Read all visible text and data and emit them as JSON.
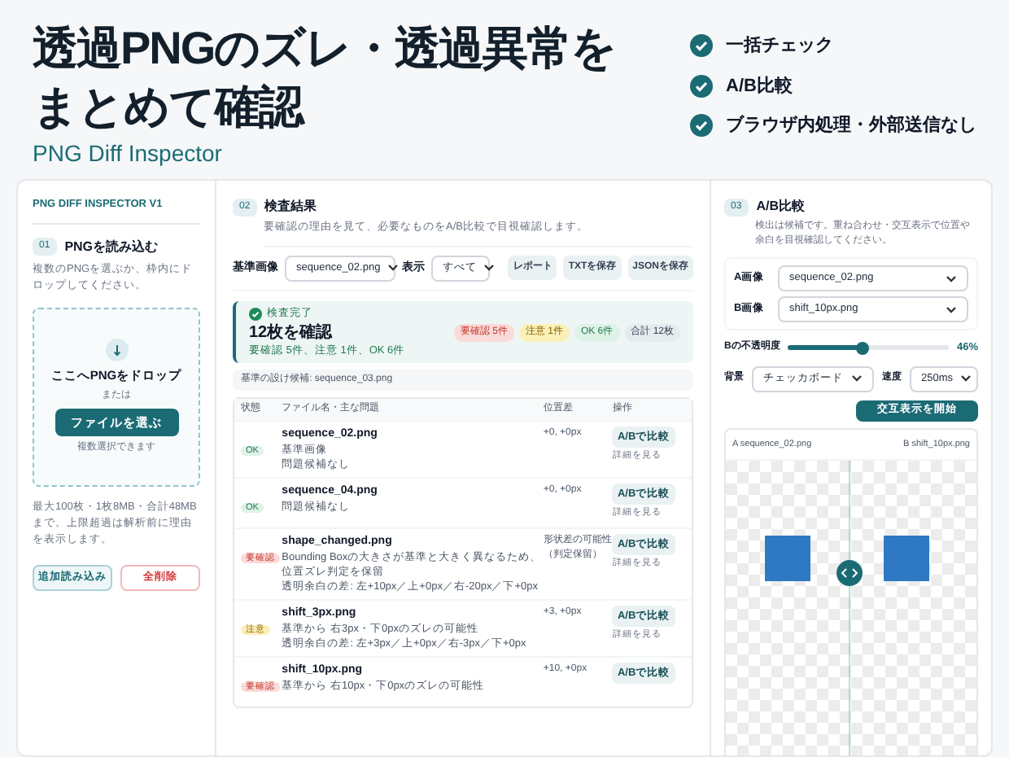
{
  "hero": {
    "title_lines": [
      "透過PNGのズレ・透過異常を",
      "まとめて確認"
    ],
    "subtitle": "PNG Diff Inspector",
    "features": [
      "一括チェック",
      "A/B比較",
      "ブラウザ内処理・外部送信なし"
    ]
  },
  "app_title": "PNG DIFF INSPECTOR V1",
  "load": {
    "step": "01",
    "title": "PNGを読み込む",
    "description": "複数のPNGを選ぶか、枠内にドロップしてください。",
    "drop_title": "ここへPNGをドロップ",
    "or": "または",
    "choose_button": "ファイルを選ぶ",
    "multi_note": "複数選択できます",
    "limits": "最大100枚・1枚8MB・合計48MBまで。上限超過は解析前に理由を表示します。",
    "add_button": "追加読み込み",
    "clear_button": "全削除"
  },
  "results": {
    "step": "02",
    "title": "検査結果",
    "description": "要確認の理由を見て、必要なものをA/B比較で目視確認します。",
    "base_label": "基準画像",
    "base_value": "sequence_02.png",
    "view_label": "表示",
    "view_value": "すべて",
    "actions": [
      "レポート",
      "TXTを保存",
      "JSONを保存"
    ],
    "summary": {
      "status": "検査完了",
      "headline": "12枚を確認",
      "detail": "要確認 5件、注意 1件、OK 6件",
      "badges": [
        {
          "kind": "error",
          "text": "要確認 5件"
        },
        {
          "kind": "warn",
          "text": "注意 1件"
        },
        {
          "kind": "ok",
          "text": "OK 6件"
        },
        {
          "kind": "total",
          "text": "合計 12枚"
        }
      ]
    },
    "hint": "基準の設け候補: sequence_03.png",
    "columns": [
      "状態",
      "ファイル名・主な問題",
      "位置差",
      "操作"
    ],
    "rows": [
      {
        "kind": "ok",
        "status": "OK",
        "file": "sequence_02.png",
        "notes": [
          "基準画像",
          "問題候補なし"
        ],
        "offset": "+0, +0px",
        "compare": "A/Bで比較",
        "details": "詳細を見る"
      },
      {
        "kind": "ok",
        "status": "OK",
        "file": "sequence_04.png",
        "notes": [
          "問題候補なし"
        ],
        "offset": "+0, +0px",
        "compare": "A/Bで比較",
        "details": "詳細を見る"
      },
      {
        "kind": "error",
        "status": "要確認",
        "file": "shape_changed.png",
        "notes": [
          "Bounding Boxの大きさが基準と大きく異なるため、位置ズレ判定を保留",
          "透明余白の差: 左+10px／上+0px／右-20px／下+0px"
        ],
        "offset": "形状差の可能性（判定保留）",
        "compare": "A/Bで比較",
        "details": "詳細を見る"
      },
      {
        "kind": "warn",
        "status": "注意",
        "file": "shift_3px.png",
        "notes": [
          "基準から 右3px・下0pxのズレの可能性",
          "透明余白の差: 左+3px／上+0px／右-3px／下+0px"
        ],
        "offset": "+3, +0px",
        "compare": "A/Bで比較",
        "details": "詳細を見る"
      },
      {
        "kind": "error",
        "status": "要確認",
        "file": "shift_10px.png",
        "notes": [
          "基準から 右10px・下0pxのズレの可能性"
        ],
        "offset": "+10, +0px",
        "compare": "A/Bで比較"
      }
    ]
  },
  "compare": {
    "step": "03",
    "title": "A/B比較",
    "description": "検出は候補です。重ね合わせ・交互表示で位置や余白を目視確認してください。",
    "a_label": "A画像",
    "a_value": "sequence_02.png",
    "b_label": "B画像",
    "b_value": "shift_10px.png",
    "opacity_label": "Bの不透明度",
    "opacity": {
      "level": 0.46,
      "reading": "46%"
    },
    "bg_label": "背景",
    "bg_value": "チェッカボード",
    "speed_label": "速度",
    "speed_value": "250ms",
    "start_button": "交互表示を開始",
    "pane_a": "A sequence_02.png",
    "pane_b": "B shift_10px.png"
  }
}
